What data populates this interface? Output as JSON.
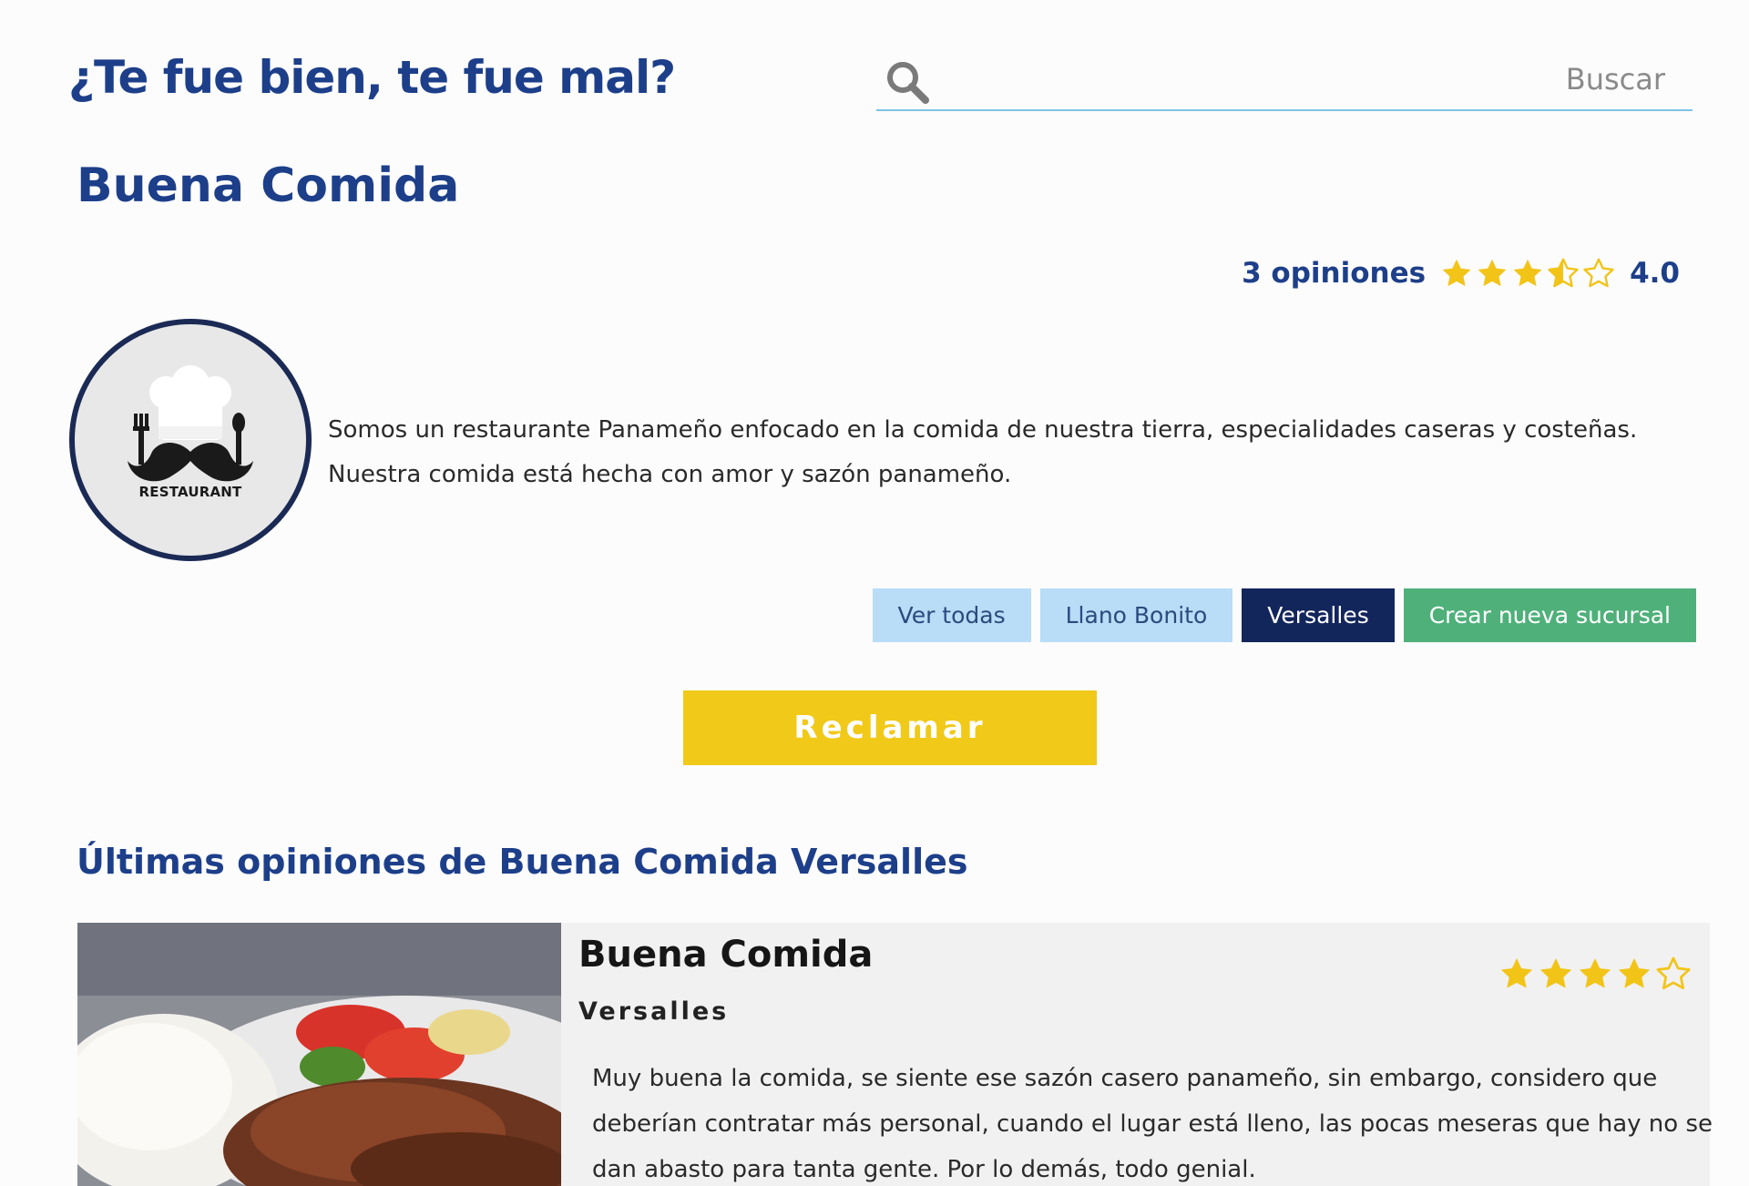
{
  "site": {
    "title": "¿Te fue bien, te fue mal?"
  },
  "search": {
    "placeholder": "Buscar",
    "value": "",
    "icon": "search-icon"
  },
  "business": {
    "name": "Buena Comida",
    "reviews_count_label": "3 opiniones",
    "rating": 3.5,
    "rating_label": "4.0",
    "logo_text": "RESTAURANT",
    "description_lines": [
      "Somos un restaurante Panameño enfocado en la comida de nuestra tierra, especialidades caseras y costeñas.",
      "Nuestra comida está hecha con amor y sazón panameño."
    ]
  },
  "branches": {
    "all_label": "Ver todas",
    "items": [
      "Llano Bonito",
      "Versalles"
    ],
    "active": "Versalles",
    "create_label": "Crear nueva sucursal"
  },
  "claim_label": "Reclamar",
  "latest": {
    "title": "Últimas opiniones de Buena Comida Versalles",
    "reviews": [
      {
        "name": "Buena Comida",
        "branch": "Versalles",
        "rating": 4,
        "text_lines": [
          "Muy buena la comida, se siente ese sazón casero panameño, sin embargo, considero que",
          "deberían contratar más personal, cuando el lugar está lleno, las pocas meseras que hay no se",
          "dan abasto para tanta gente. Por lo demás, todo genial."
        ]
      }
    ]
  },
  "colors": {
    "brand_blue": "#1d3f8a",
    "star": "#f2c418",
    "claim": "#f1c919",
    "create": "#4fb07a",
    "active_branch": "#13265c",
    "light_button": "#b9dcf7"
  }
}
